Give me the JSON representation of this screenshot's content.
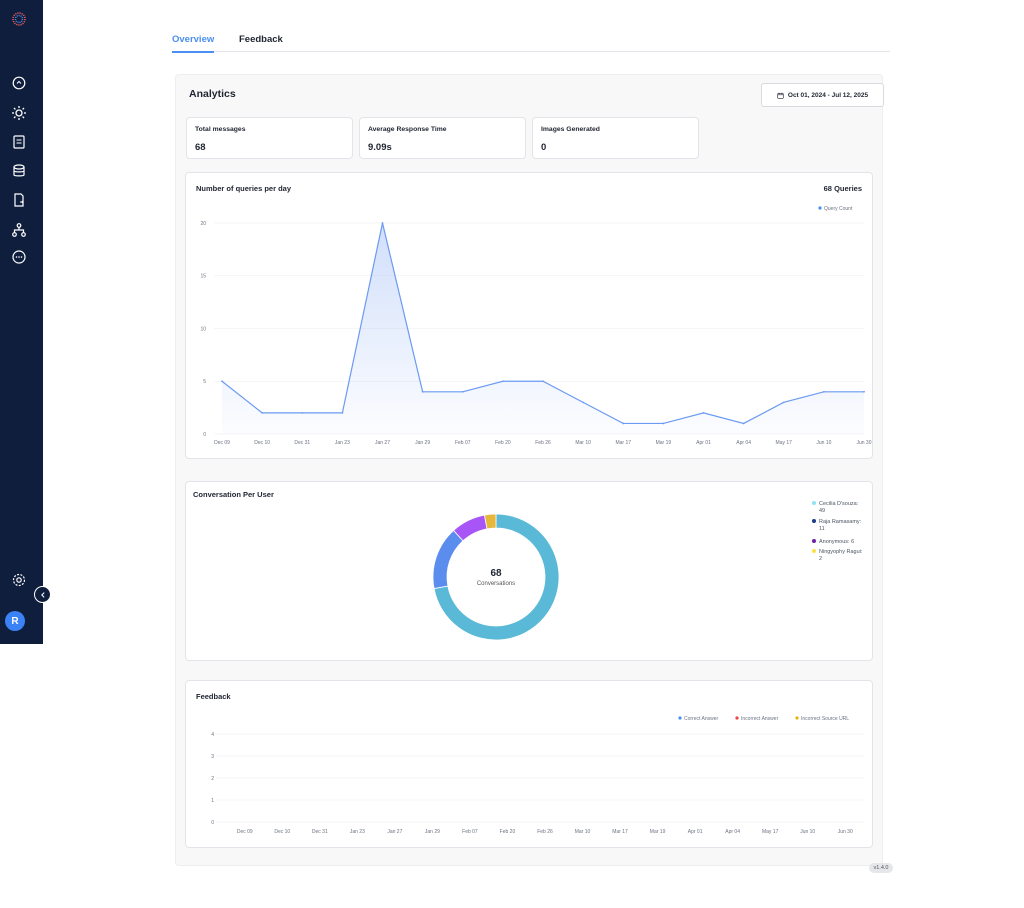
{
  "tabs": [
    {
      "label": "Overview",
      "active": true
    },
    {
      "label": "Feedback",
      "active": false
    }
  ],
  "analytics": {
    "title": "Analytics",
    "date_range": "Oct 01, 2024 - Jul 12, 2025"
  },
  "stats": [
    {
      "label": "Total messages",
      "value": "68"
    },
    {
      "label": "Average Response Time",
      "value": "9.09s"
    },
    {
      "label": "Images Generated",
      "value": "0"
    }
  ],
  "queries_card": {
    "title": "Number of queries per day",
    "total": "68 Queries",
    "legend": "Query Count"
  },
  "conversation_card": {
    "title": "Conversation Per User",
    "center_value": "68",
    "center_label": "Conversations",
    "legend": [
      {
        "label": "Cecilia D'souza: 49",
        "color": "#8fe3f0"
      },
      {
        "label": "Raja Ramasamy: 11",
        "color": "#1e3a8a"
      },
      {
        "label": "Anonymous: 6",
        "color": "#6b21a8"
      },
      {
        "label": "Ningyophy Ragui: 2",
        "color": "#fde047"
      }
    ]
  },
  "feedback_card": {
    "title": "Feedback",
    "legend": [
      {
        "label": "Correct Answer",
        "color": "#4b8ff0"
      },
      {
        "label": "Incorrect Answer",
        "color": "#ef4444"
      },
      {
        "label": "Incorrect Source URL",
        "color": "#eab308"
      }
    ]
  },
  "version": "v1.4.0",
  "user_initial": "R",
  "colors": {
    "sidebar": "#0f1e3d",
    "accent": "#4b8ff0"
  },
  "icons": [
    "logo-icon",
    "chat-icon",
    "sun-icon",
    "document-icon",
    "database-icon",
    "file-export-icon",
    "hierarchy-icon",
    "message-icon",
    "gear-icon",
    "chevron-left-icon"
  ],
  "chart_data": [
    {
      "type": "area",
      "title": "Number of queries per day",
      "categories": [
        "Dec 09",
        "Dec 10",
        "Dec 31",
        "Jan 23",
        "Jan 27",
        "Jan 29",
        "Feb 07",
        "Feb 20",
        "Feb 26",
        "Mar 10",
        "Mar 17",
        "Mar 19",
        "Apr 01",
        "Apr 04",
        "May 17",
        "Jun 10",
        "Jun 30"
      ],
      "series": [
        {
          "name": "Query Count",
          "values": [
            5,
            2,
            2,
            2,
            20,
            4,
            4,
            5,
            5,
            3,
            1,
            1,
            2,
            1,
            3,
            4,
            4
          ]
        }
      ],
      "y_ticks": [
        0,
        5,
        10,
        15,
        20
      ],
      "ylim": [
        0,
        20
      ],
      "grid": true,
      "legend_position": "top-right"
    },
    {
      "type": "pie",
      "title": "Conversation Per User",
      "categories": [
        "Cecilia D'souza",
        "Raja Ramasamy",
        "Anonymous",
        "Ningyophy Ragui"
      ],
      "values": [
        49,
        11,
        6,
        2
      ],
      "donut": true,
      "slice_colors": [
        "#5ab9d6",
        "#5b8def",
        "#a855f7",
        "#e5b83b"
      ],
      "legend_position": "right"
    },
    {
      "type": "bar",
      "title": "Feedback",
      "categories": [
        "Dec 09",
        "Dec 10",
        "Dec 31",
        "Jan 23",
        "Jan 27",
        "Jan 29",
        "Feb 07",
        "Feb 20",
        "Feb 26",
        "Mar 10",
        "Mar 17",
        "Mar 19",
        "Apr 01",
        "Apr 04",
        "May 17",
        "Jun 10",
        "Jun 30"
      ],
      "series": [
        {
          "name": "Correct Answer",
          "values": []
        },
        {
          "name": "Incorrect Answer",
          "values": []
        },
        {
          "name": "Incorrect Source URL",
          "values": []
        }
      ],
      "y_ticks": [
        0,
        1,
        2,
        3,
        4
      ],
      "ylim": [
        0,
        4
      ],
      "grid": true,
      "legend_position": "top-right"
    }
  ]
}
